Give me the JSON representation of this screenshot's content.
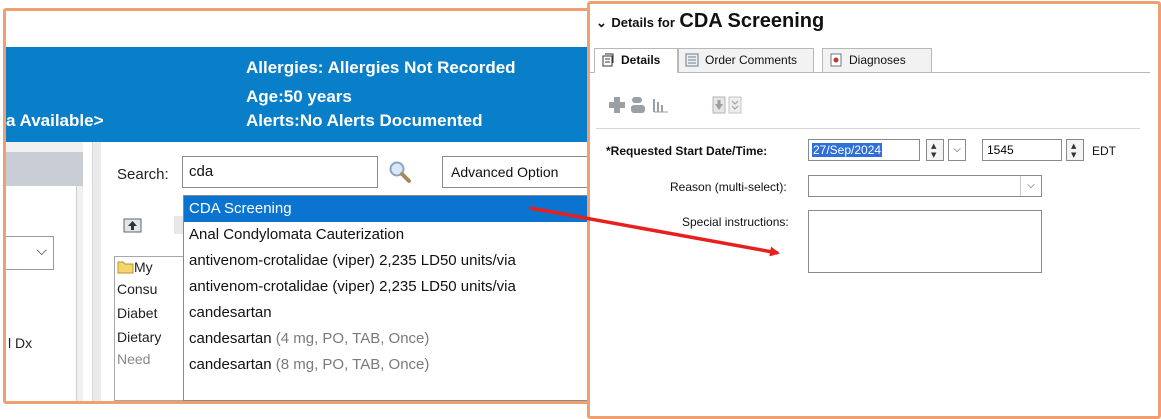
{
  "patient_banner": {
    "allergies": "Allergies: Allergies Not Recorded",
    "age": "Age:50 years",
    "availability": "a Available>",
    "alerts": "Alerts:No Alerts Documented"
  },
  "left_fragments": {
    "dx_label": "l Dx"
  },
  "search": {
    "label": "Search:",
    "value": "cda",
    "advanced_label": "Advanced Option"
  },
  "folder_list": {
    "items": [
      "My",
      "Consu",
      "Diabet",
      "Dietary",
      "Need"
    ]
  },
  "autocomplete": {
    "items": [
      {
        "name": "CDA Screening",
        "detail": "",
        "selected": true
      },
      {
        "name": "Anal Condylomata Cauterization",
        "detail": ""
      },
      {
        "name": "antivenom-crotalidae (viper) 2,235 LD50 units/via",
        "detail": ""
      },
      {
        "name": "antivenom-crotalidae (viper) 2,235 LD50 units/via",
        "detail": ""
      },
      {
        "name": "candesartan",
        "detail": ""
      },
      {
        "name": "candesartan",
        "detail": " (4 mg, PO, TAB, Once)"
      },
      {
        "name": "candesartan",
        "detail": " (8 mg, PO, TAB, Once)"
      }
    ]
  },
  "details": {
    "title_prefix": "Details for",
    "title_name": "CDA Screening",
    "tabs": [
      "Details",
      "Order Comments",
      "Diagnoses"
    ],
    "form": {
      "start_label": "*Requested Start Date/Time:",
      "start_date": "27/Sep/2024",
      "start_time": "1545",
      "timezone": "EDT",
      "reason_label": "Reason (multi-select):",
      "reason_value": "",
      "instructions_label": "Special instructions:",
      "instructions_value": ""
    }
  },
  "colors": {
    "banner_bg": "#0a7fc9",
    "selection_bg": "#0a74d0",
    "panel_border": "#f0a070",
    "arrow": "#e8201c"
  }
}
